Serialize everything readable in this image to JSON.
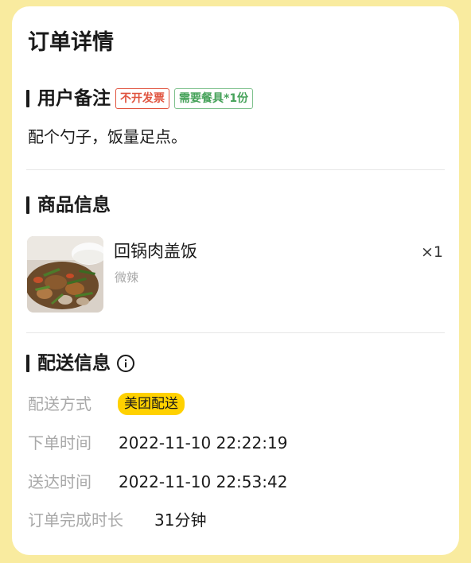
{
  "title": "订单详情",
  "remark_section": {
    "title": "用户备注",
    "tags": [
      "不开发票",
      "需要餐具*1份"
    ],
    "text": "配个勺子，饭量足点。"
  },
  "product_section": {
    "title": "商品信息",
    "product": {
      "name": "回锅肉盖饭",
      "spec": "微辣",
      "quantity": "×1",
      "image_icon": "twice-cooked-pork-rice-photo"
    }
  },
  "delivery_section": {
    "title": "配送信息",
    "info_icon": "info-icon",
    "rows": [
      {
        "label": "配送方式",
        "value": "美团配送"
      },
      {
        "label": "下单时间",
        "value": "2022-11-10 22:22:19"
      },
      {
        "label": "送达时间",
        "value": "2022-11-10 22:53:42"
      },
      {
        "label": "订单完成时长",
        "value": "31分钟"
      }
    ]
  },
  "colors": {
    "background": "#f9eb9f",
    "card": "#ffffff",
    "tag_red": "#e0543f",
    "tag_green": "#46a25a",
    "delivery_badge": "#ffd100",
    "label_gray": "#a9a9a9"
  }
}
